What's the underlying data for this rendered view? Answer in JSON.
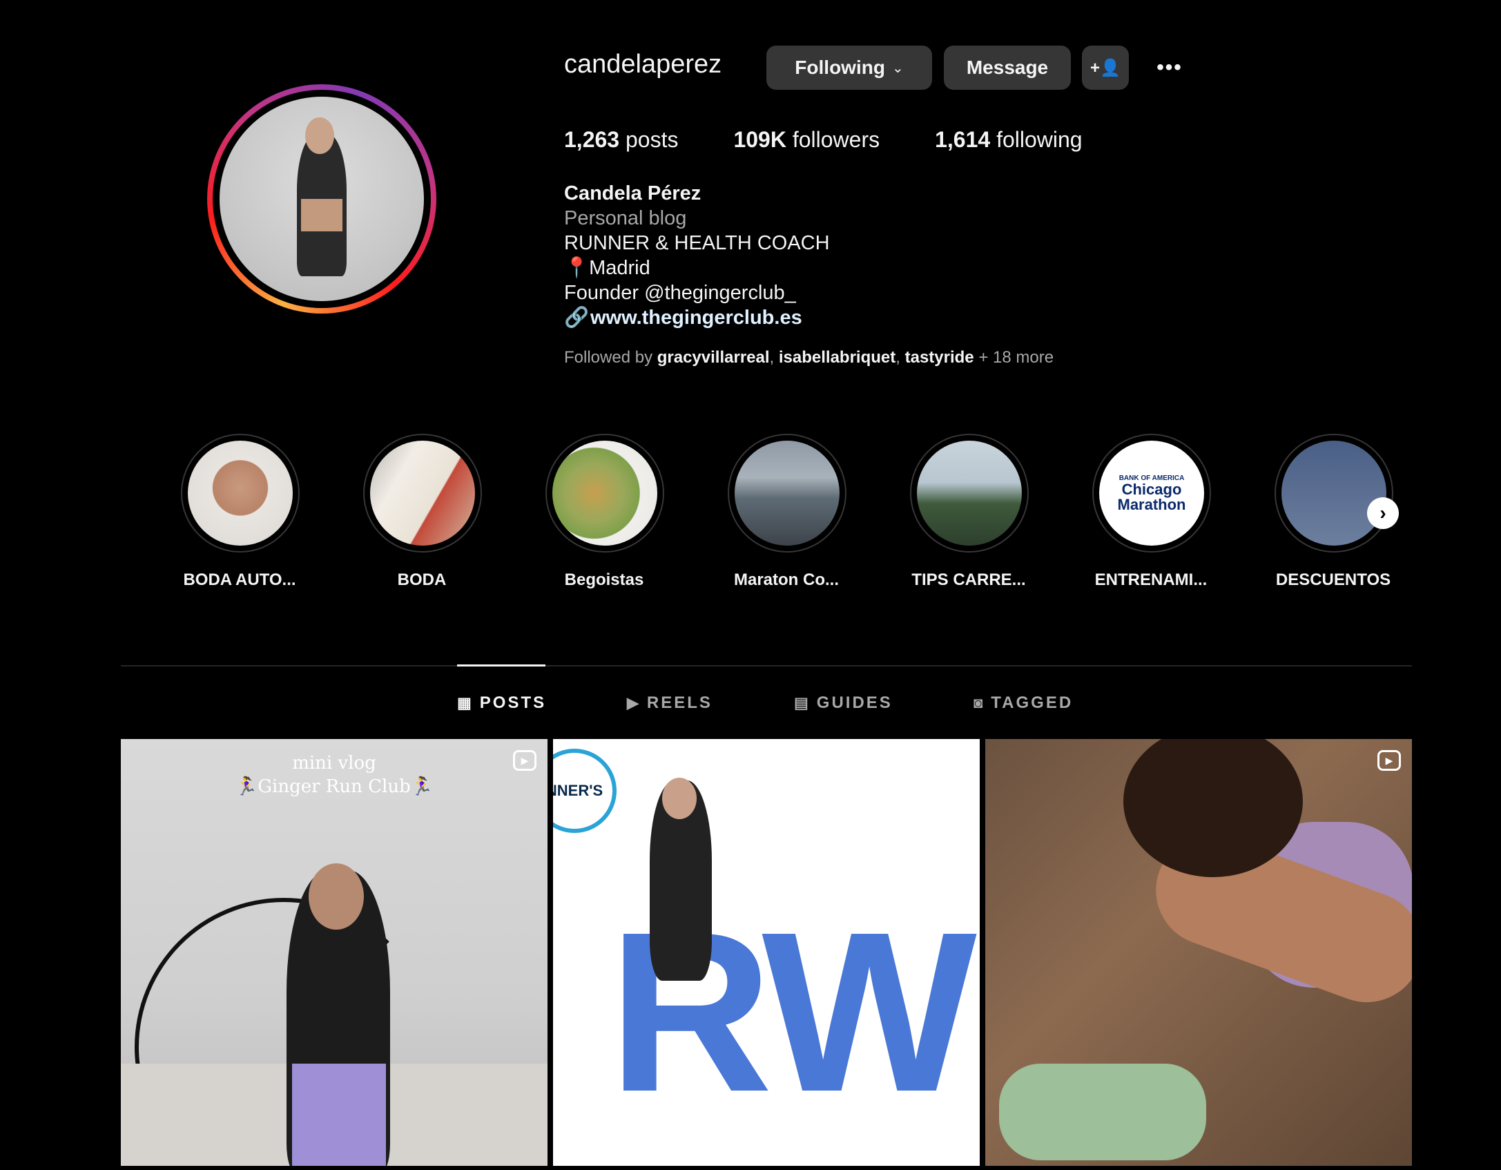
{
  "profile": {
    "username": "candelaperez",
    "following_btn": "Following",
    "following_chevron": "⌄",
    "message_btn": "Message",
    "add_user_icon": "+👤",
    "more_icon": "•••",
    "stats": {
      "posts_count": "1,263",
      "posts_label": "posts",
      "followers_count": "109K",
      "followers_label": "followers",
      "following_count": "1,614",
      "following_label": "following"
    },
    "bio": {
      "name": "Candela Pérez",
      "category": "Personal blog",
      "line1": "RUNNER & HEALTH COACH",
      "line2": "📍Madrid",
      "line3": "Founder @thegingerclub_",
      "link_icon": "🔗",
      "link": "www.thegingerclub.es"
    },
    "followed_by": {
      "prefix": "Followed by",
      "user1": "gracyvillarreal",
      "user2": "isabellabriquet",
      "user3": "tastyride",
      "suffix": "+ 18 more"
    }
  },
  "highlights": [
    {
      "label": "BODA AUTO..."
    },
    {
      "label": "BODA"
    },
    {
      "label": "Begoistas"
    },
    {
      "label": "Maraton Co..."
    },
    {
      "label": "TIPS CARRE..."
    },
    {
      "label": "ENTRENAMI..."
    },
    {
      "label": "DESCUENTOS"
    }
  ],
  "highlight_next_icon": "›",
  "chicago": {
    "line1": "BANK OF AMERICA",
    "line2": "Chicago",
    "line3": "Marathon"
  },
  "tabs": [
    {
      "label": "POSTS",
      "icon": "▦"
    },
    {
      "label": "REELS",
      "icon": "▶"
    },
    {
      "label": "GUIDES",
      "icon": "▤"
    },
    {
      "label": "TAGGED",
      "icon": "◙"
    }
  ],
  "posts": {
    "p1_line1": "mini vlog",
    "p1_line2": "🏃‍♀️Ginger Run Club🏃‍♀️",
    "reel_icon": "▶",
    "p2_badge": "NNER'S",
    "p2_letters": "RW"
  },
  "colors": {
    "background": "#000000",
    "button": "#363636",
    "link": "#e0f1ff",
    "muted": "#a8a8a8"
  }
}
